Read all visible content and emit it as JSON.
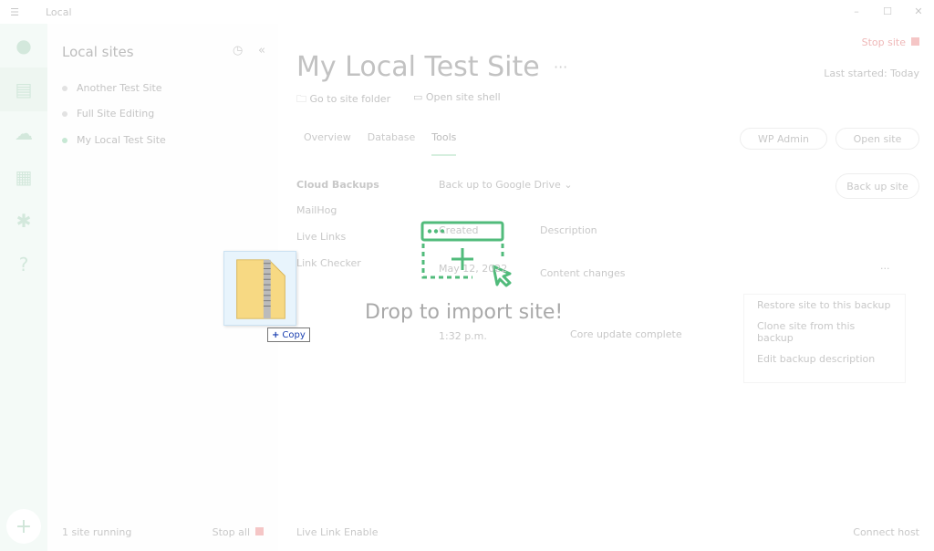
{
  "window": {
    "title": "Local",
    "menu_icon": "hamburger-icon",
    "minimize": "–",
    "maximize": "☐",
    "close": "✕"
  },
  "rail": {
    "items": [
      "avatar",
      "sites-icon",
      "cloud-icon",
      "blueprints-icon",
      "addons-icon",
      "help-icon"
    ],
    "add": "+"
  },
  "sites_panel": {
    "title": "Local sites",
    "sites": [
      {
        "name": "Another Test Site",
        "running": false
      },
      {
        "name": "Full Site Editing",
        "running": false
      },
      {
        "name": "My Local Test Site",
        "running": true
      }
    ],
    "footer_status": "1 site running",
    "footer_stop": "Stop all"
  },
  "site": {
    "title": "My Local Test Site",
    "more": "···",
    "stop": "Stop site",
    "last_started": "Last started: Today",
    "go_to_folder": "Go to site folder",
    "open_shell": "Open site shell",
    "tabs": [
      "Overview",
      "Database",
      "Tools"
    ],
    "active_tab": "Tools",
    "wp_admin": "WP Admin",
    "open_site": "Open site"
  },
  "tools": {
    "items": [
      "Cloud Backups",
      "MailHog",
      "Live Links",
      "Link Checker"
    ],
    "back_up_to": "Back up to",
    "provider": "Google Drive",
    "back_up_button": "Back up site",
    "col_created": "Created",
    "col_description": "Description",
    "rows": [
      {
        "date": "May 12, 2022",
        "time": "",
        "description": "Content changes"
      },
      {
        "date": "",
        "time": "1:32 p.m.",
        "description": "Core update complete"
      }
    ],
    "row_menu": [
      "Restore site to this backup",
      "Clone site from this backup",
      "Edit backup description"
    ]
  },
  "bottom": {
    "live_link": "Live Link",
    "enable": "Enable",
    "connect_host": "Connect host"
  },
  "overlay": {
    "message": "Drop to import site!",
    "accent": "#51bb7b"
  },
  "drag": {
    "file_icon": "zip-folder-icon",
    "copy_label": "Copy"
  }
}
